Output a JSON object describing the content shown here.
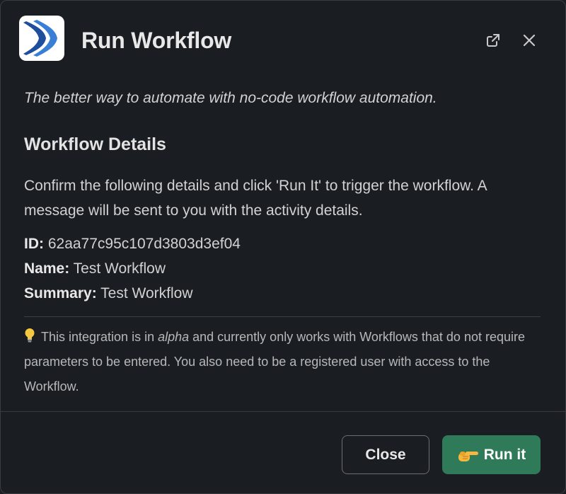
{
  "modal": {
    "title": "Run Workflow",
    "app_icon": "app-logo",
    "open_external_icon": "external-link-icon",
    "close_icon": "close-icon"
  },
  "body": {
    "tagline": "The better way to automate with no-code workflow automation.",
    "section_title": "Workflow Details",
    "confirm_text": "Confirm the following details and click 'Run It' to trigger the workflow. A message will be sent to you with the activity details.",
    "details": {
      "id_label": "ID:",
      "id_value": "62aa77c95c107d3803d3ef04",
      "name_label": "Name:",
      "name_value": "Test Workflow",
      "summary_label": "Summary:",
      "summary_value": "Test Workflow"
    },
    "note": {
      "icon": "lightbulb-icon",
      "prefix": "This integration is in ",
      "emphasis": "alpha",
      "suffix": " and currently only works with Workflows that do not require parameters to be entered. You also need to be a registered user with access to the Workflow."
    }
  },
  "footer": {
    "close_label": "Close",
    "run_label": "Run it",
    "run_icon": "pointing-hand-icon",
    "run_color": "#2f7a58"
  }
}
